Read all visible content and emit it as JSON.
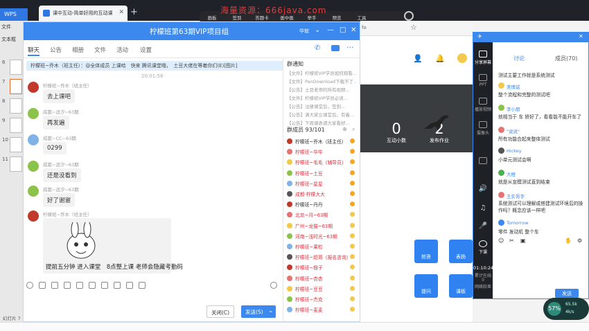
{
  "wps": {
    "tab_label": "WPS",
    "file_label": "文件",
    "left_label_1": "文本框",
    "slide_numbers": [
      "6",
      "7",
      "8",
      "9",
      "10",
      "11"
    ],
    "status_bar": "幻灯片 7"
  },
  "browser": {
    "tab_title": "课中互动-简单好用的互动课",
    "new_tab": "+",
    "url_fragment": "fo",
    "watermark": "海量资源：666java.com"
  },
  "top_toolbar": {
    "items": [
      "画板",
      "签到",
      "答题卡",
      "画中画",
      "举手",
      "预览",
      "工具"
    ]
  },
  "edu_page": {
    "stats": [
      {
        "value": "0",
        "label": "互动小数"
      },
      {
        "value": "2",
        "label": "发布作业"
      }
    ],
    "tiles": [
      "抢答",
      "表扬",
      "提问",
      "课板"
    ]
  },
  "chat": {
    "title": "柠檬班第63期VIP项目组",
    "title_badge": "华软",
    "tabs": [
      "聊天",
      "公告",
      "相册",
      "文件",
      "活动",
      "设置"
    ],
    "notice": "柠檬班~乔木（班主任）：@全体成员 上课哈　快来 腾讯课堂哦，　土豆大佬在等着你们(E)[图片]",
    "timestamp": "20:01:58",
    "messages": [
      {
        "name": "柠檬班~乔木（班主任）",
        "text": "去上课吧"
      },
      {
        "name": "成都~逗汐~63期",
        "text": "再发遍"
      },
      {
        "name": "成都~CC~63期",
        "text": "0299"
      },
      {
        "name": "成都~逗汐~63期",
        "text": "还是没看到"
      },
      {
        "name": "成都~逗汐~63期",
        "text": "好了谢谢"
      },
      {
        "name": "柠檬班~乔木（班主任）",
        "text": ""
      }
    ],
    "image_caption": "提前五分钟 进入课堂　8点整上课 老师会隐藏考勤码",
    "close_label": "关闭(C)",
    "send_label": "发送(S)",
    "group_notice_title": "群通知",
    "group_notices": [
      "【文件】柠檬班VIP学员如何观看...",
      "【文件】PanDownload下载不了...",
      "【公告】土豆老师的所有视频...",
      "【文件】柠檬班VIP学员必读...",
      "【公告】注册课堂后，签到...",
      "【公告】满大家立课堂后，有着...",
      "【公告】下周课表请大家看好..."
    ],
    "members_title": "群成员 93/101",
    "members": [
      {
        "name": "柠檬班~乔木（班主任）",
        "color": "#333333"
      },
      {
        "name": "柠檬班~华华",
        "color": "#d9333f"
      },
      {
        "name": "柠檬班~毛毛（辅导员）",
        "color": "#d9333f"
      },
      {
        "name": "柠檬班~土豆",
        "color": "#d9333f"
      },
      {
        "name": "柠檬班~星星",
        "color": "#d9333f"
      },
      {
        "name": "成都·柠檬大大",
        "color": "#d9333f"
      },
      {
        "name": "柠檬班~丹丹",
        "color": "#333333"
      },
      {
        "name": "北京~月~63期",
        "color": "#d9333f"
      },
      {
        "name": "广州~龙猫~63期",
        "color": "#d9333f"
      },
      {
        "name": "河南~浅时光~63期",
        "color": "#d9333f"
      },
      {
        "name": "柠檬班~果粒",
        "color": "#d9333f"
      },
      {
        "name": "柠檬班~超哥（报名咨询）",
        "color": "#d9333f"
      },
      {
        "name": "柠檬班~橙子",
        "color": "#d9333f"
      },
      {
        "name": "柠檬班~杏杏",
        "color": "#d9333f"
      },
      {
        "name": "柠檬班~豆豆",
        "color": "#d9333f"
      },
      {
        "name": "柠檬班~杰克",
        "color": "#d9333f"
      },
      {
        "name": "柠檬班~麦麦",
        "color": "#d9333f"
      }
    ]
  },
  "live": {
    "side_items": [
      "分享屏幕",
      "PPT",
      "播放视频",
      "摄像头",
      "",
      "",
      "",
      "下课"
    ],
    "timer": "01:10:24",
    "online_label": "累计在线",
    "online_count": "0",
    "network_label": "网络较差",
    "tabs": [
      "讨论",
      "成员(70)"
    ],
    "messages": [
      {
        "name": "",
        "text": "测试主要工作就是系统测试"
      },
      {
        "name": "美情兹",
        "text": "整个流程和完整的测试吧"
      },
      {
        "name": "李小朋",
        "text": "就相当于 车 娇好了，看看能不能开车了"
      },
      {
        "name": "\"说说\"",
        "text": "所有功能合起来整体测试"
      },
      {
        "name": "Hickey",
        "text": "小单元测试会啊"
      },
      {
        "name": "大橙",
        "text": "就是从宣模测试直到结束"
      },
      {
        "name": "王实哥字",
        "text": "系统测试可以理解成搭建测试环境后的操作吗？概念应该一样吧"
      },
      {
        "name": "Tomorrow",
        "text": "零件  发动机  整个车"
      }
    ],
    "send_label": "发送"
  },
  "net_badge": {
    "percent": "57%",
    "up": "65.5k",
    "down": "4k/s"
  }
}
